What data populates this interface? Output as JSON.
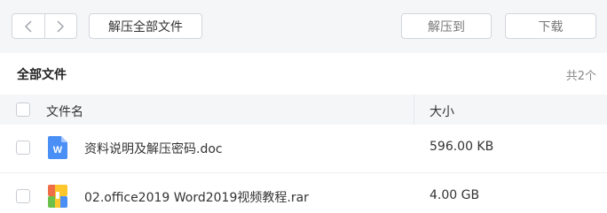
{
  "toolbar": {
    "back_icon": "chevron-left-icon",
    "forward_icon": "chevron-right-icon",
    "extract_all_label": "解压全部文件",
    "extract_to_label": "解压到",
    "download_label": "下载"
  },
  "section": {
    "title": "全部文件",
    "count": "共2个"
  },
  "columns": {
    "name": "文件名",
    "size": "大小"
  },
  "files": [
    {
      "name": "资料说明及解压密码.doc",
      "size": "596.00 KB",
      "icon": "word-doc-icon",
      "icon_color": "#4a8ff5"
    },
    {
      "name": "02.office2019 Word2019视频教程.rar",
      "size": "4.00 GB",
      "icon": "archive-icon",
      "icon_colors": [
        "#f06e45",
        "#ffc72c",
        "#6cc04a",
        "#4a8ff5"
      ]
    }
  ]
}
